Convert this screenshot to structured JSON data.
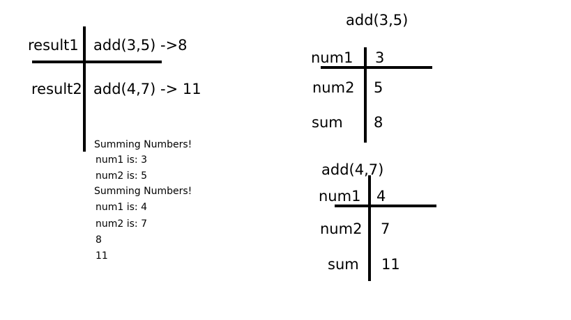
{
  "main_frame": {
    "rows": [
      {
        "name": "result1",
        "value": "add(3,5) ->8"
      },
      {
        "name": "result2",
        "value": "add(4,7) -> 11"
      }
    ]
  },
  "console_output": {
    "lines": [
      "Summing Numbers!",
      " num1 is: 3",
      " num2 is: 5",
      " Summing Numbers!",
      " num1 is: 4",
      " num2 is: 7",
      " 8",
      " 11"
    ]
  },
  "frame_add_3_5": {
    "title": "add(3,5)",
    "rows": [
      {
        "name": "num1",
        "value": "3"
      },
      {
        "name": "num2",
        "value": "5"
      },
      {
        "name": "sum",
        "value": "8"
      }
    ]
  },
  "frame_add_4_7": {
    "title": "add(4,7)",
    "rows": [
      {
        "name": "num1",
        "value": "4"
      },
      {
        "name": "num2",
        "value": "7"
      },
      {
        "name": "sum",
        "value": "11"
      }
    ]
  }
}
